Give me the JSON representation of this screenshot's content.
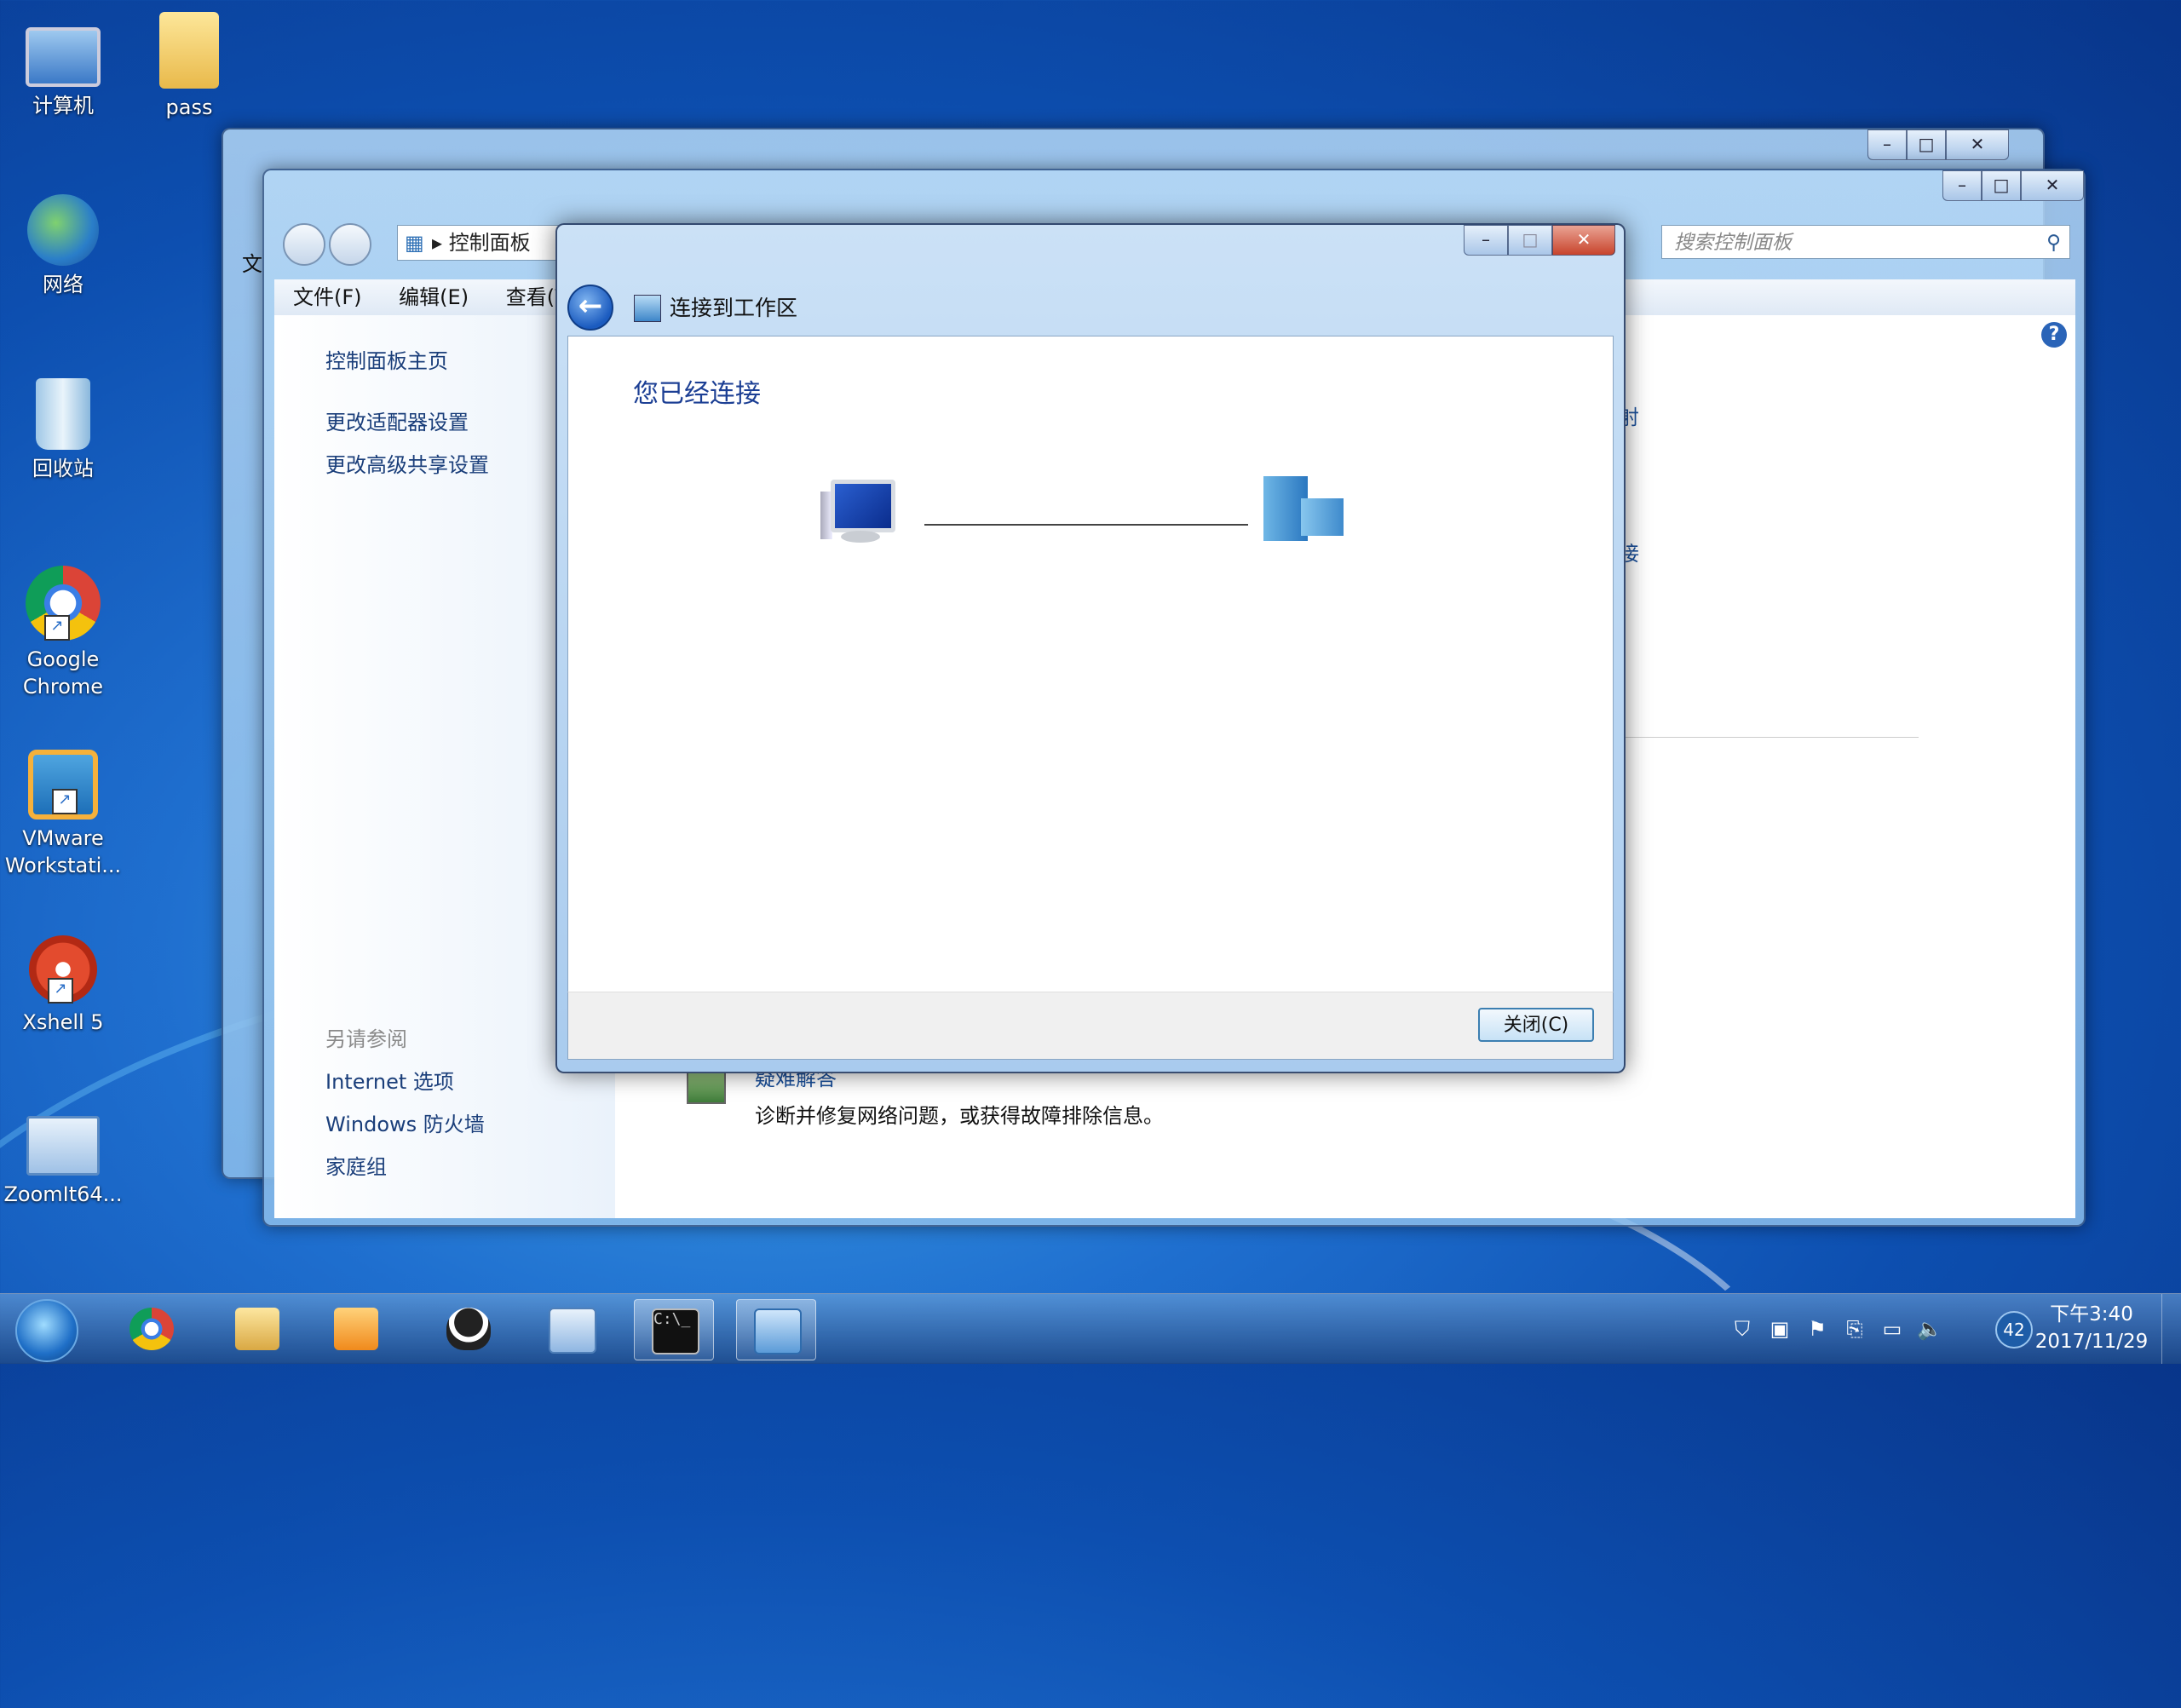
{
  "desktop": {
    "icons": [
      {
        "label": "计算机",
        "icon": "computer-icon"
      },
      {
        "label": "pass",
        "icon": "folder-icon"
      },
      {
        "label": "网络",
        "icon": "network-icon"
      },
      {
        "label": "回收站",
        "icon": "recycle-bin-icon"
      },
      {
        "label": "Google Chrome",
        "icon": "chrome-icon"
      },
      {
        "label": "VMware Workstati...",
        "icon": "vmware-icon"
      },
      {
        "label": "Xshell 5",
        "icon": "xshell-icon"
      },
      {
        "label": "ZoomIt64...",
        "icon": "zoomit-icon"
      }
    ]
  },
  "control_panel": {
    "breadcrumb": "控制面板",
    "search_placeholder": "搜索控制面板",
    "menu": [
      "文件(F)",
      "编辑(E)",
      "查看(V)"
    ],
    "left_links": [
      "控制面板主页",
      "更改适配器设置",
      "更改高级共享设置"
    ],
    "see_also_label": "另请参阅",
    "see_also": [
      "Internet 选项",
      "Windows 防火墙",
      "家庭组"
    ],
    "right_fragments": [
      "射",
      "接"
    ],
    "troubleshoot_title": "疑难解答",
    "troubleshoot_desc": "诊断并修复网络问题，或获得故障排除信息。",
    "partial_menu": "文"
  },
  "wizard": {
    "title": "连接到工作区",
    "heading": "您已经连接",
    "close_button": "关闭(C)"
  },
  "taskbar": {
    "tray_badge": "42",
    "time": "下午3:40",
    "date": "2017/11/29"
  }
}
